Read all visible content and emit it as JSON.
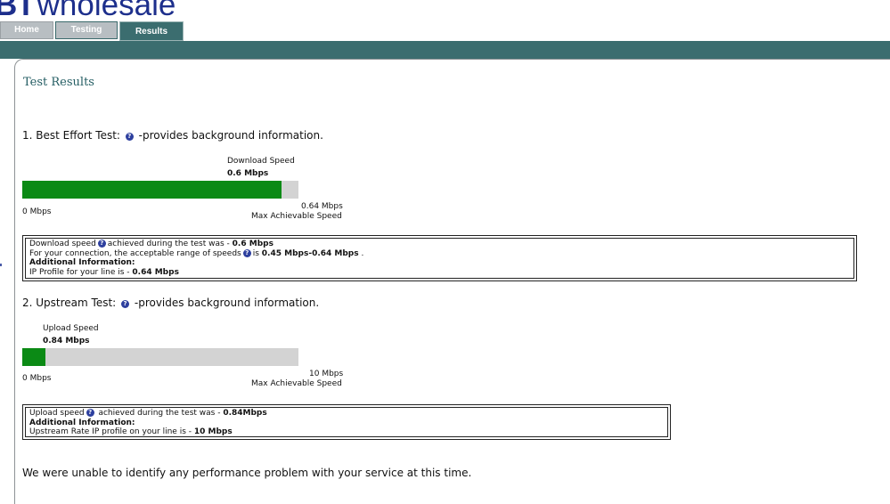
{
  "brand": {
    "bt": "BT",
    "name": "wholesale"
  },
  "tabs": [
    {
      "label": "Home"
    },
    {
      "label": "Testing"
    },
    {
      "label": "Results"
    }
  ],
  "page_title": "Test Results",
  "best_effort": {
    "heading": "1. Best Effort Test:",
    "help_suffix": "-provides background information.",
    "gauge_label": "Download Speed",
    "speed": "0.6 Mbps",
    "fill_fraction": 0.9375,
    "min_label": "0 Mbps",
    "max_value": "0.64 Mbps",
    "max_caption": "Max Achievable Speed",
    "info": {
      "line1_pre": "Download speed",
      "line1_mid": "achieved during the test was - ",
      "line1_val": "0.6 Mbps",
      "line2_pre": "For your connection, the acceptable range of speeds",
      "line2_mid": "is ",
      "line2_val": "0.45 Mbps-0.64 Mbps",
      "line2_end": " .",
      "additional": "Additional Information:",
      "line4_pre": "IP Profile for your line is - ",
      "line4_val": "0.64 Mbps"
    }
  },
  "upstream": {
    "heading": "2. Upstream Test:",
    "help_suffix": "-provides background information.",
    "gauge_label": "Upload Speed",
    "speed": "0.84 Mbps",
    "fill_fraction": 0.084,
    "min_label": "0 Mbps",
    "max_value": "10 Mbps",
    "max_caption": "Max Achievable Speed",
    "info": {
      "line1_pre": "Upload speed",
      "line1_mid": " achieved during the test was - ",
      "line1_val": "0.84Mbps",
      "additional": "Additional Information:",
      "line3_pre": "Upstream Rate IP profile on your line is - ",
      "line3_val": "10 Mbps"
    }
  },
  "final_message": "We were unable to identify any performance problem with your service at this time.",
  "colors": {
    "teal": "#3b6d6f",
    "green": "#0b8a15",
    "brand_blue": "#1d2f8c"
  }
}
